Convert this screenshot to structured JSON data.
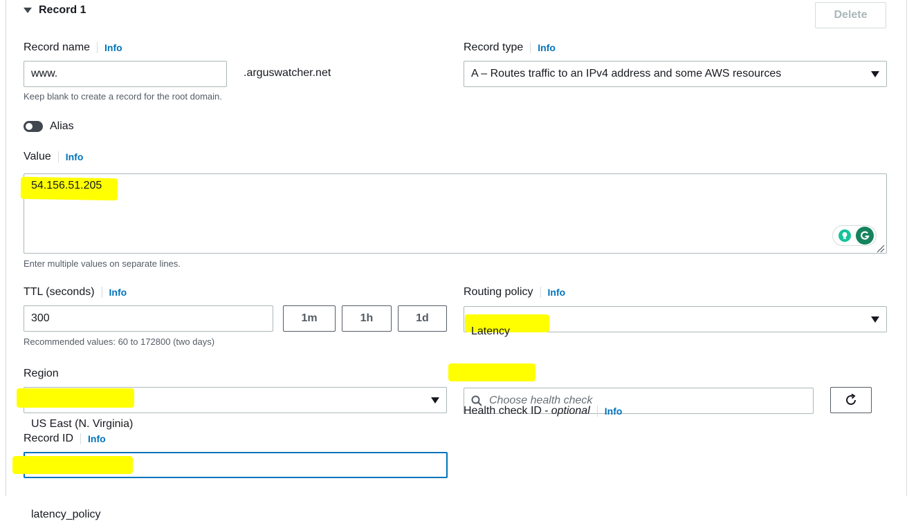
{
  "section": {
    "title": "Record 1",
    "delete_label": "Delete"
  },
  "record_name": {
    "label": "Record name",
    "info": "Info",
    "value": "www.",
    "suffix": ".arguswatcher.net",
    "hint": "Keep blank to create a record for the root domain."
  },
  "record_type": {
    "label": "Record type",
    "info": "Info",
    "value": "A – Routes traffic to an IPv4 address and some AWS resources"
  },
  "alias": {
    "label": "Alias",
    "enabled": false
  },
  "value_field": {
    "label": "Value",
    "info": "Info",
    "value": "54.156.51.205",
    "hint": "Enter multiple values on separate lines."
  },
  "ttl": {
    "label": "TTL (seconds)",
    "info": "Info",
    "value": "300",
    "presets": [
      "1m",
      "1h",
      "1d"
    ],
    "hint": "Recommended values: 60 to 172800 (two days)"
  },
  "routing_policy": {
    "label": "Routing policy",
    "info": "Info",
    "value": "Latency"
  },
  "region": {
    "label": "Region",
    "value": "US East (N. Virginia)"
  },
  "health_check": {
    "label": "Health check ID",
    "optional": "- optional",
    "info": "Info",
    "placeholder": "Choose health check"
  },
  "record_id": {
    "label": "Record ID",
    "info": "Info",
    "value": "latency_policy"
  },
  "colors": {
    "highlight": "#ffff00",
    "link": "#0073bb",
    "focus": "#0073bb"
  }
}
